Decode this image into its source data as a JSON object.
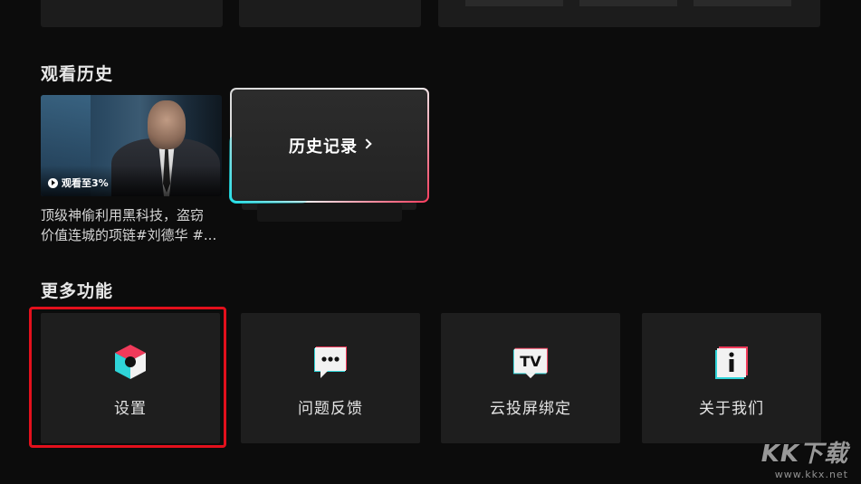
{
  "sections": {
    "history_title": "观看历史",
    "more_title": "更多功能"
  },
  "history": {
    "video": {
      "progress_text": "观看至3%",
      "title_line1": "顶级神偷利用黑科技，盗窃",
      "title_line2": "价值连城的项链#刘德华 #..."
    },
    "record_button_label": "历史记录"
  },
  "functions": [
    {
      "label": "设置",
      "icon": "settings-cube-icon",
      "selected": true
    },
    {
      "label": "问题反馈",
      "icon": "feedback-chat-icon",
      "selected": false
    },
    {
      "label": "云投屏绑定",
      "icon": "tv-cast-icon",
      "selected": false
    },
    {
      "label": "关于我们",
      "icon": "info-icon",
      "selected": false
    }
  ],
  "colors": {
    "background": "#0c0c0c",
    "tile": "#1e1e1e",
    "focus_red": "#e3101c",
    "accent_cyan": "#21e0e8",
    "accent_pink": "#ff3a5c"
  },
  "watermark": {
    "main": "KK下载",
    "url": "www.kkx.net"
  }
}
